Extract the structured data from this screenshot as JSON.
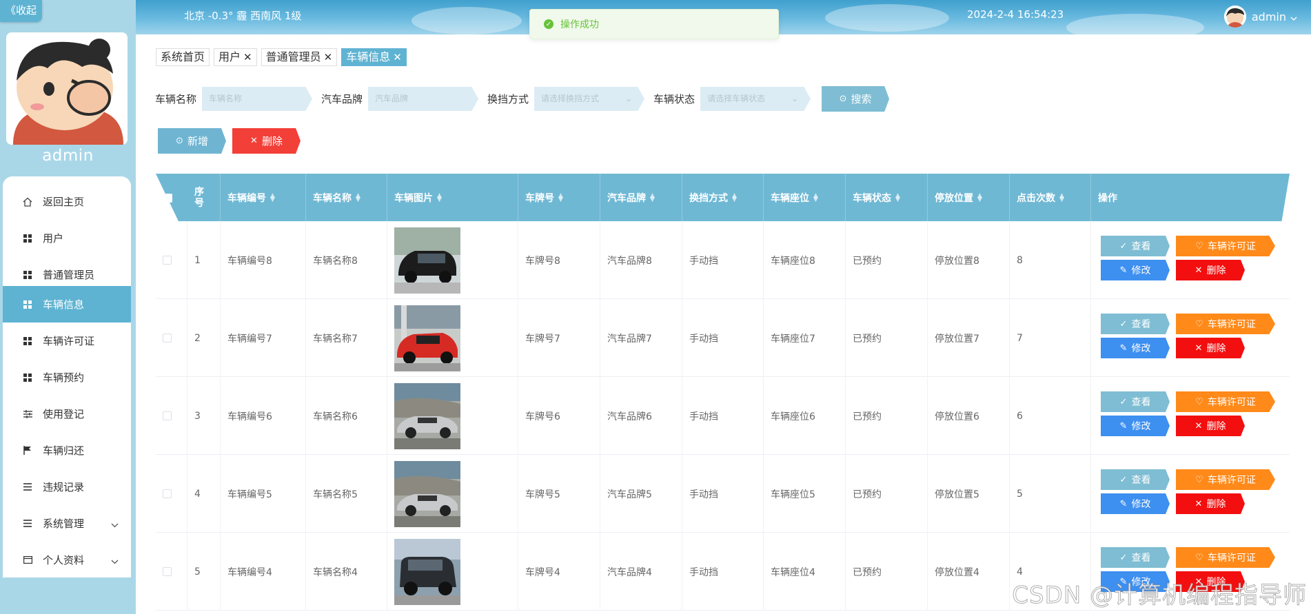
{
  "sidebar": {
    "collapse_label": "《收起",
    "username": "admin",
    "items": [
      {
        "label": "返回主页",
        "icon": "home-icon"
      },
      {
        "label": "用户",
        "icon": "grid-icon"
      },
      {
        "label": "普通管理员",
        "icon": "grid-icon"
      },
      {
        "label": "车辆信息",
        "icon": "grid-icon",
        "active": true
      },
      {
        "label": "车辆许可证",
        "icon": "grid-icon"
      },
      {
        "label": "车辆预约",
        "icon": "grid-icon"
      },
      {
        "label": "使用登记",
        "icon": "sliders-icon"
      },
      {
        "label": "车辆归还",
        "icon": "flag-icon"
      },
      {
        "label": "违规记录",
        "icon": "list-icon"
      },
      {
        "label": "系统管理",
        "icon": "list-icon",
        "expandable": true
      },
      {
        "label": "个人资料",
        "icon": "card-icon",
        "expandable": true
      }
    ]
  },
  "header": {
    "weather": "北京  -0.3°  霾  西南风  1级",
    "datetime": "2024-2-4 16:54:23",
    "username": "admin"
  },
  "toast": {
    "message": "操作成功"
  },
  "tabs": [
    {
      "label": "系统首页",
      "closable": false
    },
    {
      "label": "用户",
      "closable": true
    },
    {
      "label": "普通管理员",
      "closable": true
    },
    {
      "label": "车辆信息",
      "closable": true,
      "active": true
    }
  ],
  "search": {
    "fields": [
      {
        "label": "车辆名称",
        "placeholder": "车辆名称",
        "type": "input"
      },
      {
        "label": "汽车品牌",
        "placeholder": "汽车品牌",
        "type": "input"
      },
      {
        "label": "换挡方式",
        "placeholder": "请选择换挡方式",
        "type": "select"
      },
      {
        "label": "车辆状态",
        "placeholder": "请选择车辆状态",
        "type": "select"
      }
    ],
    "button": "搜索"
  },
  "actions": {
    "add": "新增",
    "delete": "删除"
  },
  "table": {
    "columns": [
      "序号",
      "车辆编号",
      "车辆名称",
      "车辆图片",
      "车牌号",
      "汽车品牌",
      "换挡方式",
      "车辆座位",
      "车辆状态",
      "停放位置",
      "点击次数",
      "操作"
    ],
    "rows": [
      {
        "idx": "1",
        "code": "车辆编号8",
        "name": "车辆名称8",
        "plate": "车牌号8",
        "brand": "汽车品牌8",
        "gear": "手动挡",
        "seat": "车辆座位8",
        "status": "已预约",
        "park": "停放位置8",
        "clicks": "8",
        "car": "black"
      },
      {
        "idx": "2",
        "code": "车辆编号7",
        "name": "车辆名称7",
        "plate": "车牌号7",
        "brand": "汽车品牌7",
        "gear": "手动挡",
        "seat": "车辆座位7",
        "status": "已预约",
        "park": "停放位置7",
        "clicks": "7",
        "car": "red"
      },
      {
        "idx": "3",
        "code": "车辆编号6",
        "name": "车辆名称6",
        "plate": "车牌号6",
        "brand": "汽车品牌6",
        "gear": "手动挡",
        "seat": "车辆座位6",
        "status": "已预约",
        "park": "停放位置6",
        "clicks": "6",
        "car": "silver"
      },
      {
        "idx": "4",
        "code": "车辆编号5",
        "name": "车辆名称5",
        "plate": "车牌号5",
        "brand": "汽车品牌5",
        "gear": "手动挡",
        "seat": "车辆座位5",
        "status": "已预约",
        "park": "停放位置5",
        "clicks": "5",
        "car": "silver"
      },
      {
        "idx": "5",
        "code": "车辆编号4",
        "name": "车辆名称4",
        "plate": "车牌号4",
        "brand": "汽车品牌4",
        "gear": "手动挡",
        "seat": "车辆座位4",
        "status": "已预约",
        "park": "停放位置4",
        "clicks": "4",
        "car": "dark"
      }
    ],
    "row_actions": {
      "view": "查看",
      "permit": "车辆许可证",
      "edit": "修改",
      "delete": "删除"
    }
  },
  "watermark": "CSDN @计算机编程指导师"
}
